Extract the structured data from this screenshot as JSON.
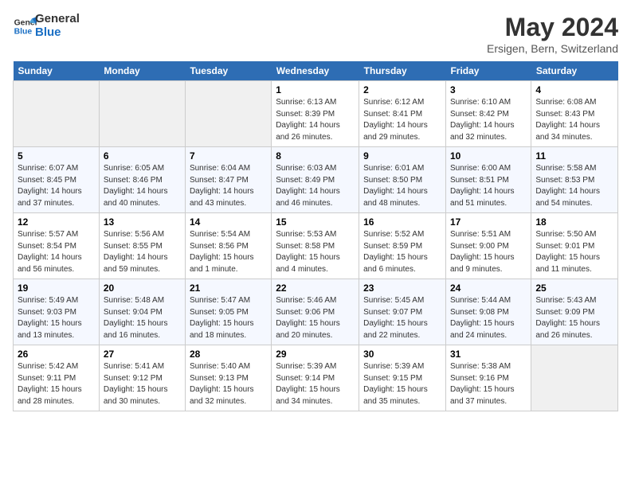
{
  "header": {
    "logo_line1": "General",
    "logo_line2": "Blue",
    "title": "May 2024",
    "subtitle": "Ersigen, Bern, Switzerland"
  },
  "weekdays": [
    "Sunday",
    "Monday",
    "Tuesday",
    "Wednesday",
    "Thursday",
    "Friday",
    "Saturday"
  ],
  "weeks": [
    [
      {
        "day": "",
        "info": ""
      },
      {
        "day": "",
        "info": ""
      },
      {
        "day": "",
        "info": ""
      },
      {
        "day": "1",
        "info": "Sunrise: 6:13 AM\nSunset: 8:39 PM\nDaylight: 14 hours and 26 minutes."
      },
      {
        "day": "2",
        "info": "Sunrise: 6:12 AM\nSunset: 8:41 PM\nDaylight: 14 hours and 29 minutes."
      },
      {
        "day": "3",
        "info": "Sunrise: 6:10 AM\nSunset: 8:42 PM\nDaylight: 14 hours and 32 minutes."
      },
      {
        "day": "4",
        "info": "Sunrise: 6:08 AM\nSunset: 8:43 PM\nDaylight: 14 hours and 34 minutes."
      }
    ],
    [
      {
        "day": "5",
        "info": "Sunrise: 6:07 AM\nSunset: 8:45 PM\nDaylight: 14 hours and 37 minutes."
      },
      {
        "day": "6",
        "info": "Sunrise: 6:05 AM\nSunset: 8:46 PM\nDaylight: 14 hours and 40 minutes."
      },
      {
        "day": "7",
        "info": "Sunrise: 6:04 AM\nSunset: 8:47 PM\nDaylight: 14 hours and 43 minutes."
      },
      {
        "day": "8",
        "info": "Sunrise: 6:03 AM\nSunset: 8:49 PM\nDaylight: 14 hours and 46 minutes."
      },
      {
        "day": "9",
        "info": "Sunrise: 6:01 AM\nSunset: 8:50 PM\nDaylight: 14 hours and 48 minutes."
      },
      {
        "day": "10",
        "info": "Sunrise: 6:00 AM\nSunset: 8:51 PM\nDaylight: 14 hours and 51 minutes."
      },
      {
        "day": "11",
        "info": "Sunrise: 5:58 AM\nSunset: 8:53 PM\nDaylight: 14 hours and 54 minutes."
      }
    ],
    [
      {
        "day": "12",
        "info": "Sunrise: 5:57 AM\nSunset: 8:54 PM\nDaylight: 14 hours and 56 minutes."
      },
      {
        "day": "13",
        "info": "Sunrise: 5:56 AM\nSunset: 8:55 PM\nDaylight: 14 hours and 59 minutes."
      },
      {
        "day": "14",
        "info": "Sunrise: 5:54 AM\nSunset: 8:56 PM\nDaylight: 15 hours and 1 minute."
      },
      {
        "day": "15",
        "info": "Sunrise: 5:53 AM\nSunset: 8:58 PM\nDaylight: 15 hours and 4 minutes."
      },
      {
        "day": "16",
        "info": "Sunrise: 5:52 AM\nSunset: 8:59 PM\nDaylight: 15 hours and 6 minutes."
      },
      {
        "day": "17",
        "info": "Sunrise: 5:51 AM\nSunset: 9:00 PM\nDaylight: 15 hours and 9 minutes."
      },
      {
        "day": "18",
        "info": "Sunrise: 5:50 AM\nSunset: 9:01 PM\nDaylight: 15 hours and 11 minutes."
      }
    ],
    [
      {
        "day": "19",
        "info": "Sunrise: 5:49 AM\nSunset: 9:03 PM\nDaylight: 15 hours and 13 minutes."
      },
      {
        "day": "20",
        "info": "Sunrise: 5:48 AM\nSunset: 9:04 PM\nDaylight: 15 hours and 16 minutes."
      },
      {
        "day": "21",
        "info": "Sunrise: 5:47 AM\nSunset: 9:05 PM\nDaylight: 15 hours and 18 minutes."
      },
      {
        "day": "22",
        "info": "Sunrise: 5:46 AM\nSunset: 9:06 PM\nDaylight: 15 hours and 20 minutes."
      },
      {
        "day": "23",
        "info": "Sunrise: 5:45 AM\nSunset: 9:07 PM\nDaylight: 15 hours and 22 minutes."
      },
      {
        "day": "24",
        "info": "Sunrise: 5:44 AM\nSunset: 9:08 PM\nDaylight: 15 hours and 24 minutes."
      },
      {
        "day": "25",
        "info": "Sunrise: 5:43 AM\nSunset: 9:09 PM\nDaylight: 15 hours and 26 minutes."
      }
    ],
    [
      {
        "day": "26",
        "info": "Sunrise: 5:42 AM\nSunset: 9:11 PM\nDaylight: 15 hours and 28 minutes."
      },
      {
        "day": "27",
        "info": "Sunrise: 5:41 AM\nSunset: 9:12 PM\nDaylight: 15 hours and 30 minutes."
      },
      {
        "day": "28",
        "info": "Sunrise: 5:40 AM\nSunset: 9:13 PM\nDaylight: 15 hours and 32 minutes."
      },
      {
        "day": "29",
        "info": "Sunrise: 5:39 AM\nSunset: 9:14 PM\nDaylight: 15 hours and 34 minutes."
      },
      {
        "day": "30",
        "info": "Sunrise: 5:39 AM\nSunset: 9:15 PM\nDaylight: 15 hours and 35 minutes."
      },
      {
        "day": "31",
        "info": "Sunrise: 5:38 AM\nSunset: 9:16 PM\nDaylight: 15 hours and 37 minutes."
      },
      {
        "day": "",
        "info": ""
      }
    ]
  ]
}
